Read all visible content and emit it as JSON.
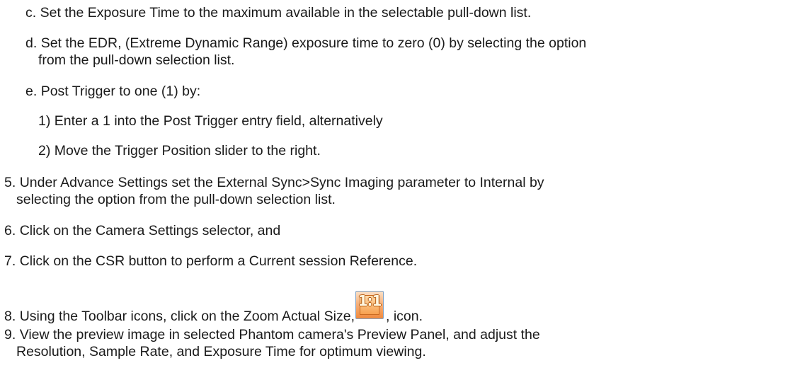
{
  "items": {
    "c": {
      "marker": "c.",
      "text": "Set the Exposure Time to the maximum available in the selectable pull-down list."
    },
    "d": {
      "marker": "d.",
      "line1": "Set the EDR, (Extreme Dynamic Range) exposure time to zero (0) by selecting the option",
      "line2": "from the pull-down selection list."
    },
    "e": {
      "marker": "e.",
      "text": "Post Trigger to one (1) by:"
    },
    "e1": {
      "marker": "1)",
      "text": "Enter a 1 into the Post Trigger entry field, alternatively"
    },
    "e2": {
      "marker": "2)",
      "text": "Move the Trigger Position slider to the right."
    },
    "s5": {
      "marker": "5.",
      "line1": "Under Advance Settings set the External Sync>Sync Imaging parameter to Internal by",
      "line2": "selecting the option from the pull-down selection list."
    },
    "s6": {
      "marker": "6.",
      "text": "Click on the Camera Settings selector, and"
    },
    "s7": {
      "marker": "7.",
      "text": "Click on the CSR button to perform a Current session Reference."
    },
    "s8": {
      "marker": "8.",
      "text_before": "Using the Toolbar icons, click on the Zoom Actual Size,",
      "icon_label": "1:1",
      "icon_name": "zoom-actual-size-icon",
      "text_after": ", icon."
    },
    "s9": {
      "marker": "9.",
      "line1": "View the preview image in selected Phantom camera's Preview Panel, and adjust the",
      "line2": "Resolution, Sample Rate, and Exposure Time for optimum viewing."
    }
  }
}
